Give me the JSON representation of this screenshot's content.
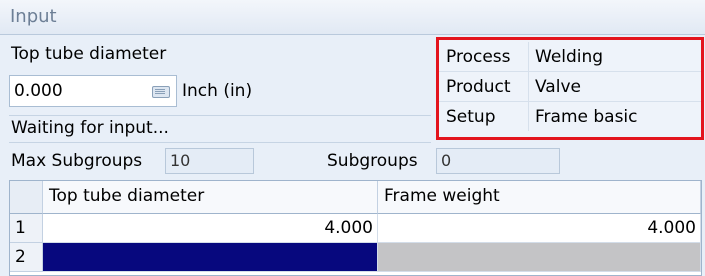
{
  "panel": {
    "title": "Input"
  },
  "measurement": {
    "label": "Top tube diameter",
    "value": "0.000",
    "unit": "Inch (in)",
    "status": "Waiting for input..."
  },
  "info": {
    "rows": [
      {
        "key": "Process",
        "value": "Welding"
      },
      {
        "key": "Product",
        "value": "Valve"
      },
      {
        "key": "Setup",
        "value": "Frame basic"
      }
    ]
  },
  "subgroups": {
    "max_label": "Max Subgroups",
    "max_value": "10",
    "count_label": "Subgroups",
    "count_value": "0"
  },
  "grid": {
    "columns": [
      "Top tube diameter",
      "Frame weight"
    ],
    "rows": [
      {
        "num": "1",
        "cells": [
          "4.000",
          "4.000"
        ]
      },
      {
        "num": "2",
        "cells": [
          "",
          ""
        ]
      }
    ]
  },
  "colors": {
    "highlight_border": "#e3141d",
    "selected_cell": "#07087e",
    "disabled_cell": "#c4c4c6"
  }
}
